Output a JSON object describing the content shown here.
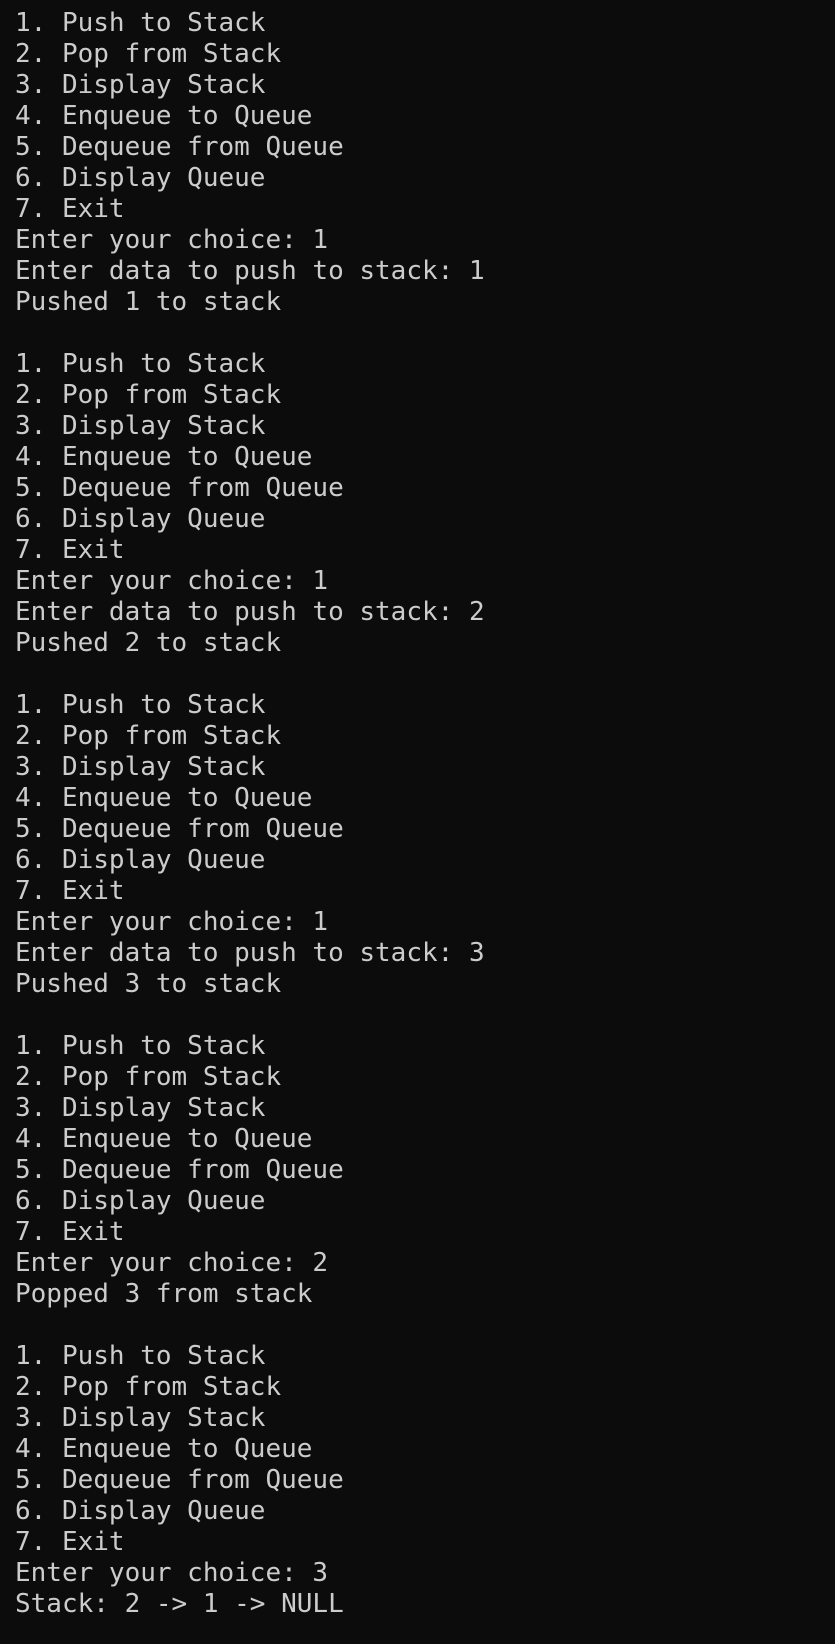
{
  "terminal": {
    "lines": [
      "1. Push to Stack",
      "2. Pop from Stack",
      "3. Display Stack",
      "4. Enqueue to Queue",
      "5. Dequeue from Queue",
      "6. Display Queue",
      "7. Exit",
      "Enter your choice: 1",
      "Enter data to push to stack: 1",
      "Pushed 1 to stack",
      "",
      "1. Push to Stack",
      "2. Pop from Stack",
      "3. Display Stack",
      "4. Enqueue to Queue",
      "5. Dequeue from Queue",
      "6. Display Queue",
      "7. Exit",
      "Enter your choice: 1",
      "Enter data to push to stack: 2",
      "Pushed 2 to stack",
      "",
      "1. Push to Stack",
      "2. Pop from Stack",
      "3. Display Stack",
      "4. Enqueue to Queue",
      "5. Dequeue from Queue",
      "6. Display Queue",
      "7. Exit",
      "Enter your choice: 1",
      "Enter data to push to stack: 3",
      "Pushed 3 to stack",
      "",
      "1. Push to Stack",
      "2. Pop from Stack",
      "3. Display Stack",
      "4. Enqueue to Queue",
      "5. Dequeue from Queue",
      "6. Display Queue",
      "7. Exit",
      "Enter your choice: 2",
      "Popped 3 from stack",
      "",
      "1. Push to Stack",
      "2. Pop from Stack",
      "3. Display Stack",
      "4. Enqueue to Queue",
      "5. Dequeue from Queue",
      "6. Display Queue",
      "7. Exit",
      "Enter your choice: 3",
      "Stack: 2 -> 1 -> NULL"
    ]
  },
  "colors": {
    "background": "#0c0c0c",
    "text": "#cccccc"
  }
}
